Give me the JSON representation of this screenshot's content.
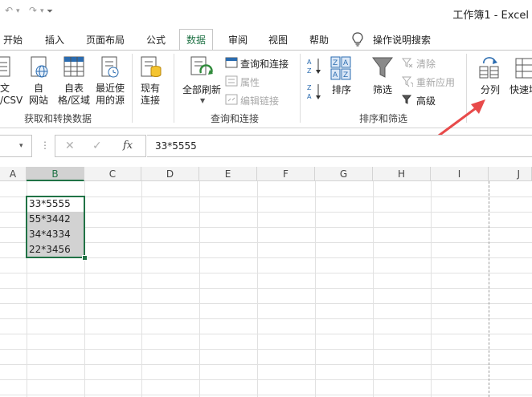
{
  "title_bar": {
    "doc_title": "工作簿1  -  Excel"
  },
  "tabs": [
    "开始",
    "插入",
    "页面布局",
    "公式",
    "数据",
    "审阅",
    "视图",
    "帮助",
    "操作说明搜索"
  ],
  "ribbon": {
    "get_data": {
      "from_csv": "从文\n本/CSV",
      "from_web": "自\n网站",
      "from_table": "自表\n格/区域",
      "recent_sources": "最近使\n用的源",
      "existing_conn": "现有\n连接",
      "group_label": "获取和转换数据"
    },
    "queries": {
      "refresh_all": "全部刷新",
      "queries_conn": "查询和连接",
      "properties": "属性",
      "edit_links": "编辑链接",
      "group_label": "查询和连接"
    },
    "sort_filter": {
      "sort": "排序",
      "filter": "筛选",
      "clear": "清除",
      "reapply": "重新应用",
      "advanced": "高级",
      "group_label": "排序和筛选"
    },
    "data_tools": {
      "text_to_columns": "分列",
      "flash_fill": "快速填"
    }
  },
  "formula_bar": {
    "fx": "fx",
    "content": "33*5555"
  },
  "grid": {
    "columns": [
      "A",
      "B",
      "C",
      "D",
      "E",
      "F",
      "G",
      "H",
      "I",
      "J"
    ],
    "selected_column": "B",
    "cells": [
      "33*5555",
      "55*3442",
      "34*4334",
      "22*3456"
    ]
  },
  "colors": {
    "accent": "#217346",
    "arrow": "#e84a4a",
    "selection_fill": "#d2d2d2"
  }
}
